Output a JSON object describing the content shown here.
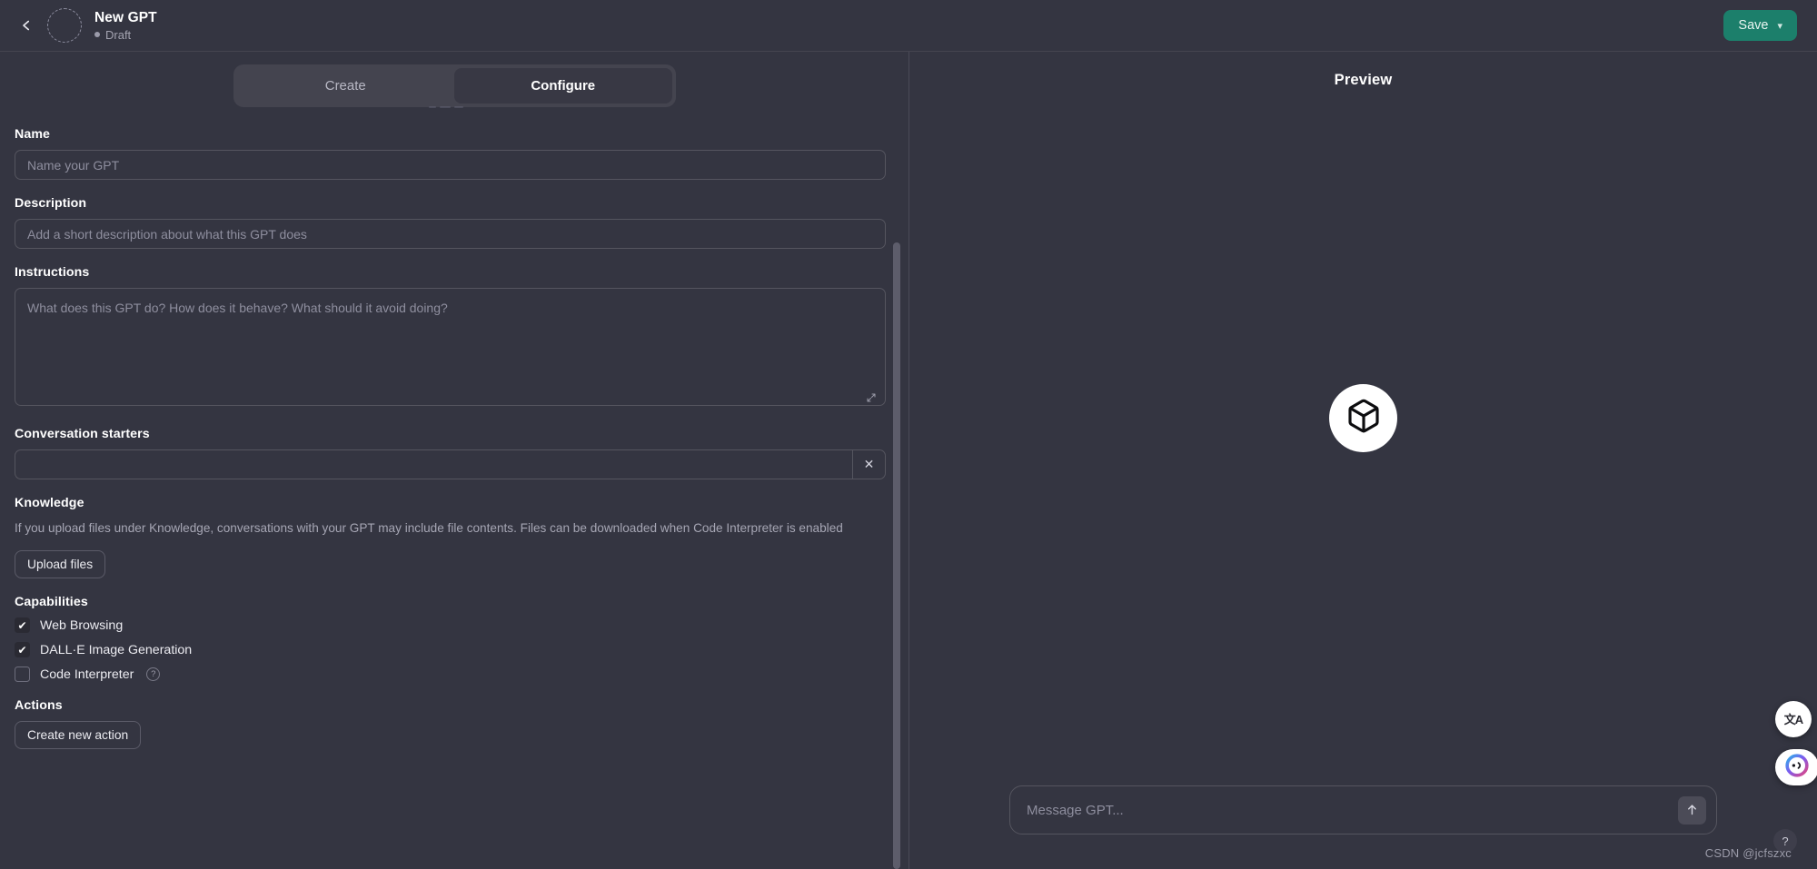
{
  "topbar": {
    "back_icon": "chevron-left-icon",
    "title": "New GPT",
    "status": "Draft",
    "save_label": "Save",
    "save_chevron": "▾",
    "save_color": "#1c7f6b"
  },
  "tabs": [
    {
      "label": "Create",
      "active": false
    },
    {
      "label": "Configure",
      "active": true
    }
  ],
  "form": {
    "name": {
      "label": "Name",
      "value": "",
      "placeholder": "Name your GPT"
    },
    "description": {
      "label": "Description",
      "value": "",
      "placeholder": "Add a short description about what this GPT does"
    },
    "instructions": {
      "label": "Instructions",
      "value": "",
      "placeholder": "What does this GPT do? How does it behave? What should it avoid doing?"
    },
    "conversation_starters": {
      "label": "Conversation starters",
      "value": "",
      "placeholder": "",
      "remove_label": "✕"
    },
    "knowledge": {
      "label": "Knowledge",
      "help": "If you upload files under Knowledge, conversations with your GPT may include file contents. Files can be downloaded when Code Interpreter is enabled",
      "upload_label": "Upload files"
    },
    "capabilities": {
      "label": "Capabilities",
      "items": [
        {
          "label": "Web Browsing",
          "checked": true,
          "has_help": false
        },
        {
          "label": "DALL·E Image Generation",
          "checked": true,
          "has_help": false
        },
        {
          "label": "Code Interpreter",
          "checked": false,
          "has_help": true,
          "help_glyph": "?"
        }
      ]
    },
    "actions": {
      "label": "Actions",
      "create_label": "Create new action"
    }
  },
  "preview": {
    "title": "Preview",
    "avatar_icon": "cube-icon",
    "composer_placeholder": "Message GPT...",
    "send_icon": "arrow-up-icon"
  },
  "floating": {
    "translate_icon": "translate-icon",
    "translate_glyph": "文A",
    "assistant_icon": "assistant-orb-icon",
    "help_glyph": "?"
  },
  "watermark": "CSDN @jcfszxc"
}
